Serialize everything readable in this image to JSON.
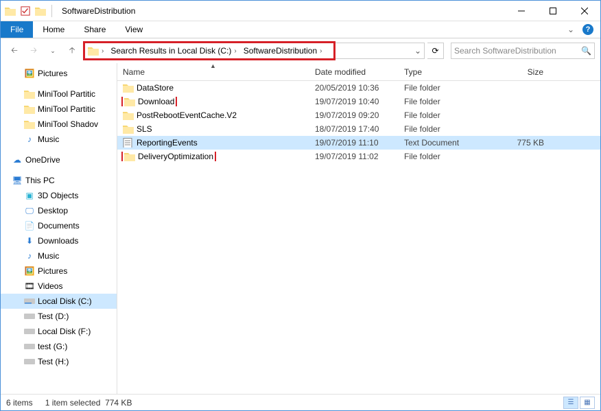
{
  "window": {
    "title": "SoftwareDistribution"
  },
  "ribbon": {
    "file": "File",
    "home": "Home",
    "share": "Share",
    "view": "View"
  },
  "breadcrumb": {
    "seg1": "Search Results in Local Disk (C:)",
    "seg2": "SoftwareDistribution"
  },
  "search": {
    "placeholder": "Search SoftwareDistribution"
  },
  "tree": {
    "pictures": "Pictures",
    "mt1": "MiniTool Partitic",
    "mt2": "MiniTool Partitic",
    "mt3": "MiniTool Shadov",
    "music": "Music",
    "onedrive": "OneDrive",
    "thispc": "This PC",
    "objects3d": "3D Objects",
    "desktop": "Desktop",
    "documents": "Documents",
    "downloads": "Downloads",
    "music2": "Music",
    "pictures2": "Pictures",
    "videos": "Videos",
    "localc": "Local Disk (C:)",
    "testd": "Test (D:)",
    "localf": "Local Disk (F:)",
    "testg": "test (G:)",
    "testh": "Test (H:)"
  },
  "columns": {
    "name": "Name",
    "date": "Date modified",
    "type": "Type",
    "size": "Size"
  },
  "files": [
    {
      "name": "DataStore",
      "date": "20/05/2019 10:36",
      "type": "File folder",
      "size": "",
      "icon": "folder",
      "highlight": false,
      "selected": false
    },
    {
      "name": "Download",
      "date": "19/07/2019 10:40",
      "type": "File folder",
      "size": "",
      "icon": "folder",
      "highlight": true,
      "selected": false
    },
    {
      "name": "PostRebootEventCache.V2",
      "date": "19/07/2019 09:20",
      "type": "File folder",
      "size": "",
      "icon": "folder",
      "highlight": false,
      "selected": false
    },
    {
      "name": "SLS",
      "date": "18/07/2019 17:40",
      "type": "File folder",
      "size": "",
      "icon": "folder",
      "highlight": false,
      "selected": false
    },
    {
      "name": "ReportingEvents",
      "date": "19/07/2019 11:10",
      "type": "Text Document",
      "size": "775 KB",
      "icon": "text",
      "highlight": false,
      "selected": true
    },
    {
      "name": "DeliveryOptimization",
      "date": "19/07/2019 11:02",
      "type": "File folder",
      "size": "",
      "icon": "folder",
      "highlight": true,
      "selected": false
    }
  ],
  "status": {
    "count": "6 items",
    "selected": "1 item selected",
    "size": "774 KB"
  }
}
